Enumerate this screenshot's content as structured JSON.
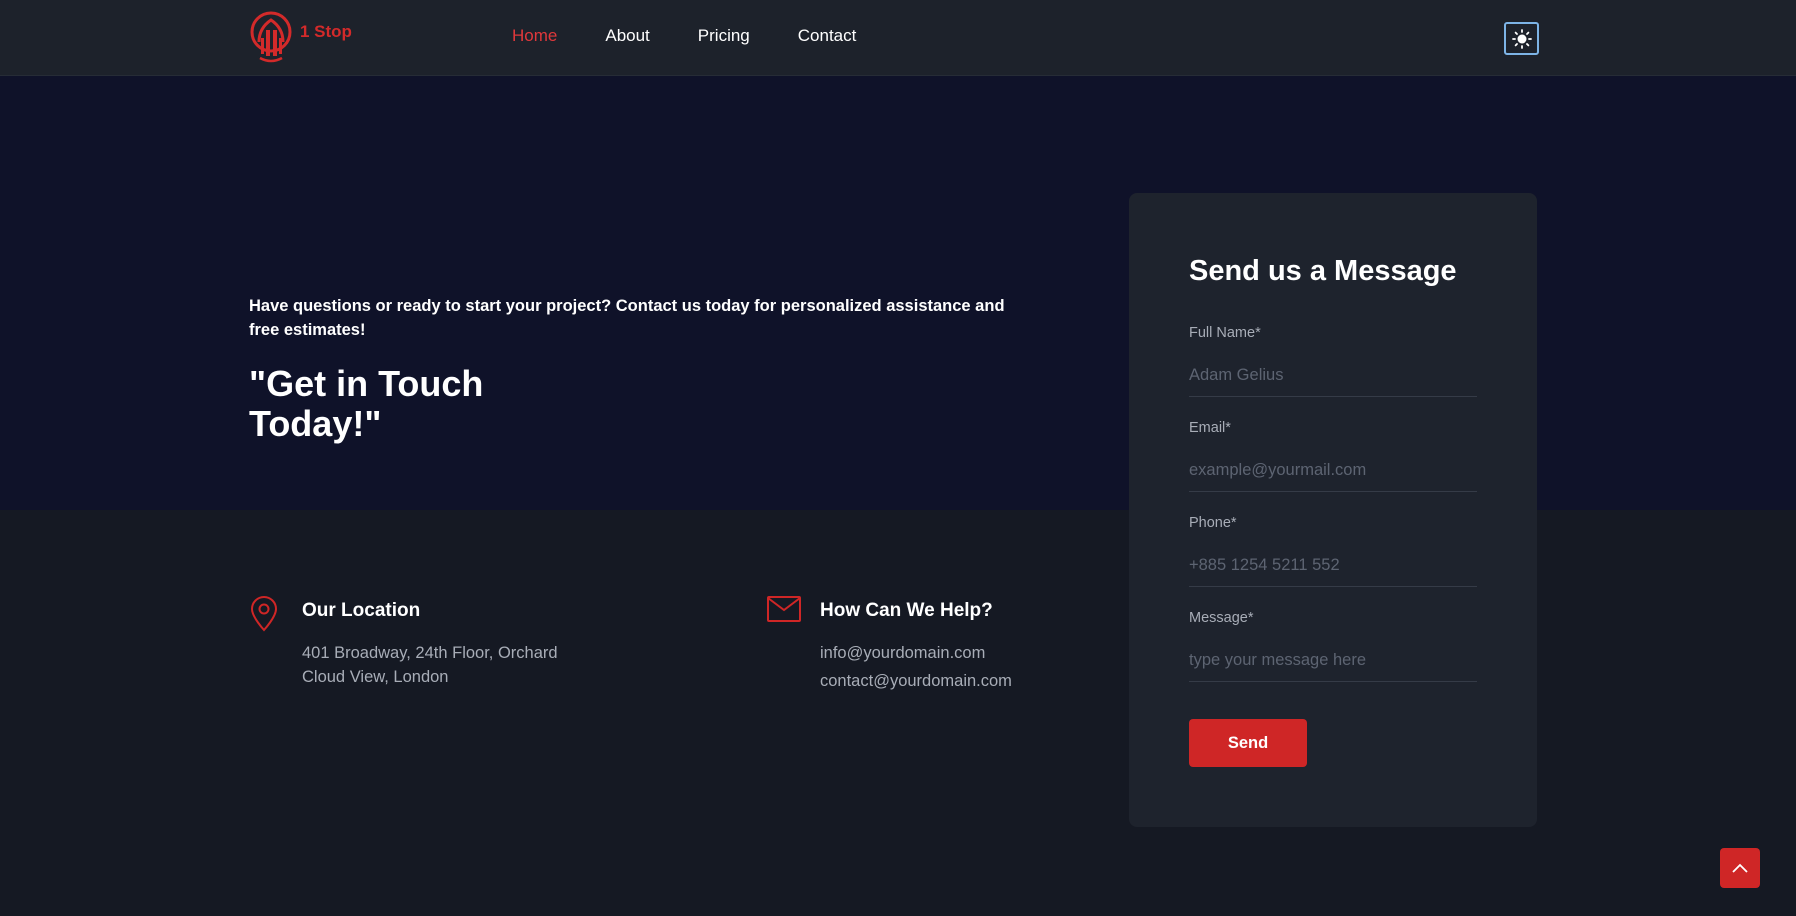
{
  "header": {
    "logo_text": "1 Stop",
    "nav": [
      {
        "label": "Home",
        "active": true
      },
      {
        "label": "About",
        "active": false
      },
      {
        "label": "Pricing",
        "active": false
      },
      {
        "label": "Contact",
        "active": false
      }
    ],
    "theme_toggle_icon": "sun-icon"
  },
  "hero": {
    "subtitle": "Have questions or ready to start your project? Contact us today for personalized assistance and free estimates!",
    "title": "\"Get in Touch Today!\""
  },
  "info": {
    "location": {
      "icon": "map-pin-icon",
      "title": "Our Location",
      "lines": [
        "401 Broadway, 24th Floor, Orchard",
        "Cloud View, London"
      ]
    },
    "help": {
      "icon": "envelope-icon",
      "title": "How Can We Help?",
      "lines": [
        "info@yourdomain.com",
        "contact@yourdomain.com"
      ]
    }
  },
  "form": {
    "title": "Send us a Message",
    "fields": [
      {
        "label": "Full Name*",
        "placeholder": "Adam Gelius",
        "value": ""
      },
      {
        "label": "Email*",
        "placeholder": "example@yourmail.com",
        "value": ""
      },
      {
        "label": "Phone*",
        "placeholder": "+885 1254 5211 552",
        "value": ""
      },
      {
        "label": "Message*",
        "placeholder": "type your message here",
        "value": ""
      }
    ],
    "submit_label": "Send"
  },
  "scroll_top_icon": "chevron-up-icon",
  "colors": {
    "accent": "#cf2626",
    "header_bg": "#1d222b",
    "hero_bg": "#0f1229",
    "page_bg": "#151923",
    "card_bg": "#1e232d"
  }
}
